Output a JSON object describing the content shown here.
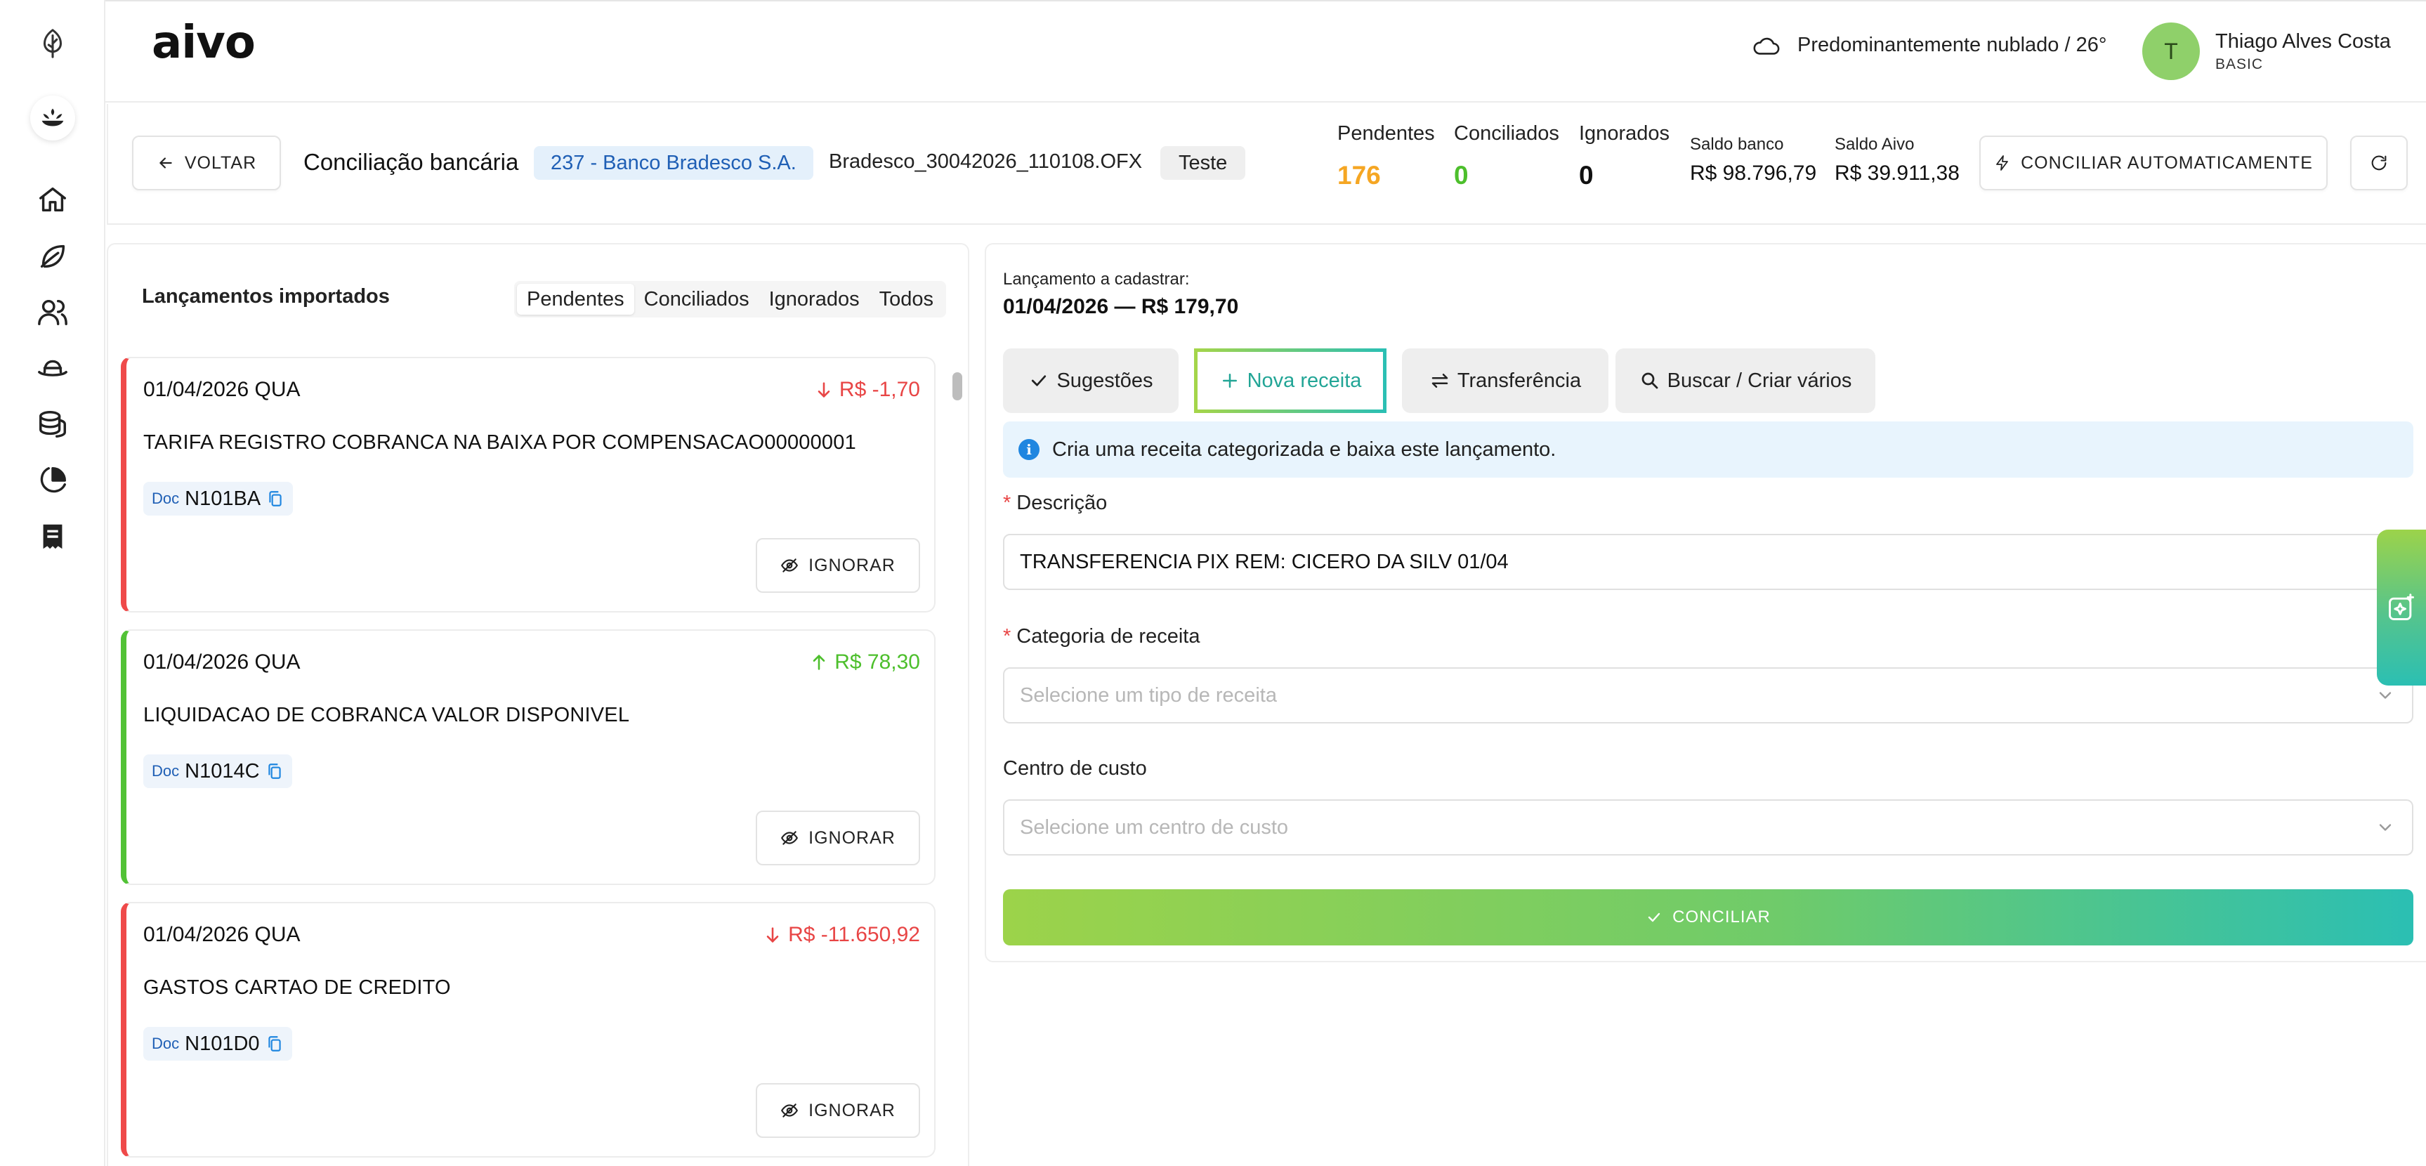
{
  "header": {
    "brand": "aivo",
    "weather": "Predominantemente nublado / 26°",
    "user": {
      "initial": "T",
      "name": "Thiago Alves Costa",
      "plan": "BASIC"
    }
  },
  "sidebar": {
    "items": [
      {
        "icon": "leaf-logo-icon"
      },
      {
        "icon": "organization-avatar-icon"
      },
      {
        "icon": "home-icon"
      },
      {
        "icon": "leaf-icon"
      },
      {
        "icon": "users-icon"
      },
      {
        "icon": "hat-icon"
      },
      {
        "icon": "coins-icon"
      },
      {
        "icon": "pie-chart-icon"
      },
      {
        "icon": "receipt-icon"
      }
    ]
  },
  "toolbar": {
    "back_label": "VOLTAR",
    "title": "Conciliação bancária",
    "bank": "237 - Banco Bradesco S.A.",
    "file": "Bradesco_30042026_110108.OFX",
    "tag": "Teste",
    "stats": {
      "pending_label": "Pendentes",
      "pending_value": "176",
      "reconciled_label": "Conciliados",
      "reconciled_value": "0",
      "ignored_label": "Ignorados",
      "ignored_value": "0"
    },
    "balances": {
      "bank_label": "Saldo banco",
      "bank_value": "R$ 98.796,79",
      "aivo_label": "Saldo Aivo",
      "aivo_value": "R$ 39.911,38"
    },
    "auto_label": "CONCILIAR AUTOMATICAMENTE"
  },
  "imported": {
    "title": "Lançamentos importados",
    "filters": [
      "Pendentes",
      "Conciliados",
      "Ignorados",
      "Todos"
    ],
    "active_filter": "Pendentes",
    "transactions": [
      {
        "date": "01/04/2026 QUA",
        "amount": "R$ -1,70",
        "direction": "out",
        "description": "TARIFA REGISTRO COBRANCA NA BAIXA POR COMPENSACAO00000001",
        "doc_label": "Doc",
        "doc": "N101BA",
        "ignore_label": "IGNORAR"
      },
      {
        "date": "01/04/2026 QUA",
        "amount": "R$ 78,30",
        "direction": "in",
        "description": "LIQUIDACAO DE COBRANCA VALOR DISPONIVEL",
        "doc_label": "Doc",
        "doc": "N1014C",
        "ignore_label": "IGNORAR"
      },
      {
        "date": "01/04/2026 QUA",
        "amount": "R$ -11.650,92",
        "direction": "out",
        "description": "GASTOS CARTAO DE CREDITO",
        "doc_label": "Doc",
        "doc": "N101D0",
        "ignore_label": "IGNORAR"
      }
    ]
  },
  "detail": {
    "caption": "Lançamento a cadastrar:",
    "summary": "01/04/2026 — R$ 179,70",
    "modes": [
      {
        "label": "Sugestões",
        "icon": "check-icon"
      },
      {
        "label": "Nova receita",
        "icon": "plus-icon"
      },
      {
        "label": "Transferência",
        "icon": "transfer-arrows-icon"
      },
      {
        "label": "Buscar / Criar vários",
        "icon": "search-icon"
      }
    ],
    "active_mode": "Nova receita",
    "info": "Cria uma receita categorizada e baixa este lançamento.",
    "description_label": "Descrição",
    "description_value": "TRANSFERENCIA PIX REM: CICERO DA SILV 01/04",
    "category_label": "Categoria de receita",
    "category_placeholder": "Selecione um tipo de receita",
    "cost_center_label": "Centro de custo",
    "cost_center_placeholder": "Selecione um centro de custo",
    "submit_label": "CONCILIAR"
  },
  "colors": {
    "pending": "#f5a623",
    "reconciled": "#4dbf2c",
    "negative": "#e84545",
    "positive": "#4dbf2c",
    "accent_start": "#9cd34a",
    "accent_end": "#2bbfb3",
    "bank_chip_bg": "#e4f0fb"
  }
}
